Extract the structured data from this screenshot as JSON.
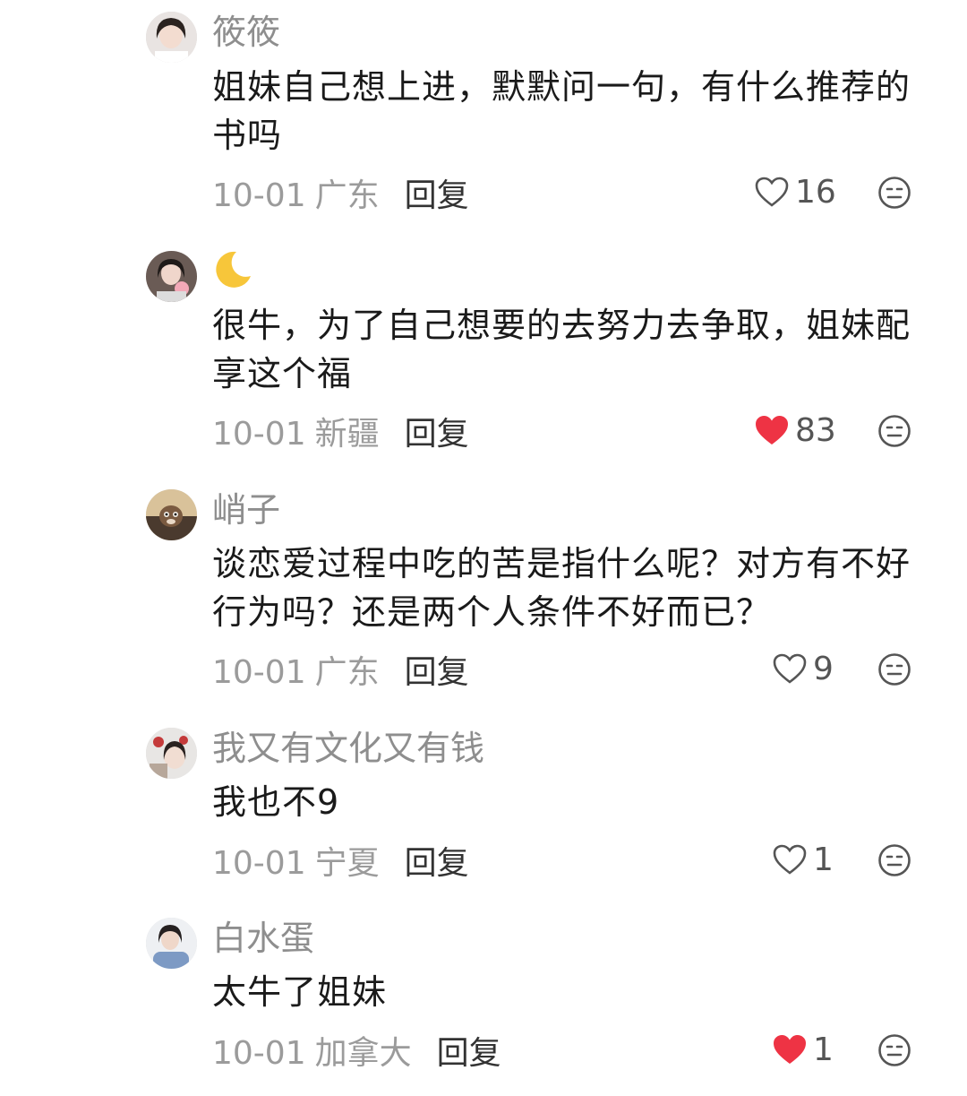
{
  "reply_label": "回复",
  "comments": [
    {
      "username": "筱筱",
      "text_lines": [
        "姐妹自己想上进，默默问一句，有什么推荐的",
        "书吗"
      ],
      "date": "10-01",
      "location": "广东",
      "likes": "16",
      "liked": false
    },
    {
      "username": "🌙",
      "text_lines": [
        "很牛，为了自己想要的去努力去争取，姐妹配",
        "享这个福"
      ],
      "date": "10-01",
      "location": "新疆",
      "likes": "83",
      "liked": true
    },
    {
      "username": "峭子",
      "text_lines": [
        "谈恋爱过程中吃的苦是指什么呢？对方有不好",
        "行为吗？还是两个人条件不好而已？"
      ],
      "date": "10-01",
      "location": "广东",
      "likes": "9",
      "liked": false
    },
    {
      "username": "我又有文化又有钱",
      "text_lines": [
        "我也不9"
      ],
      "date": "10-01",
      "location": "宁夏",
      "likes": "1",
      "liked": false
    },
    {
      "username": "白水蛋",
      "text_lines": [
        "太牛了姐妹"
      ],
      "date": "10-01",
      "location": "加拿大",
      "likes": "1",
      "liked": true
    }
  ],
  "colors": {
    "liked_heart": "#ee3344",
    "username": "#8e8e8e",
    "text": "#1a1a1a",
    "meta": "#9b9b9b"
  },
  "icons": {
    "like": "heart-outline-icon",
    "liked": "heart-filled-icon",
    "dislike": "neutral-face-icon"
  }
}
